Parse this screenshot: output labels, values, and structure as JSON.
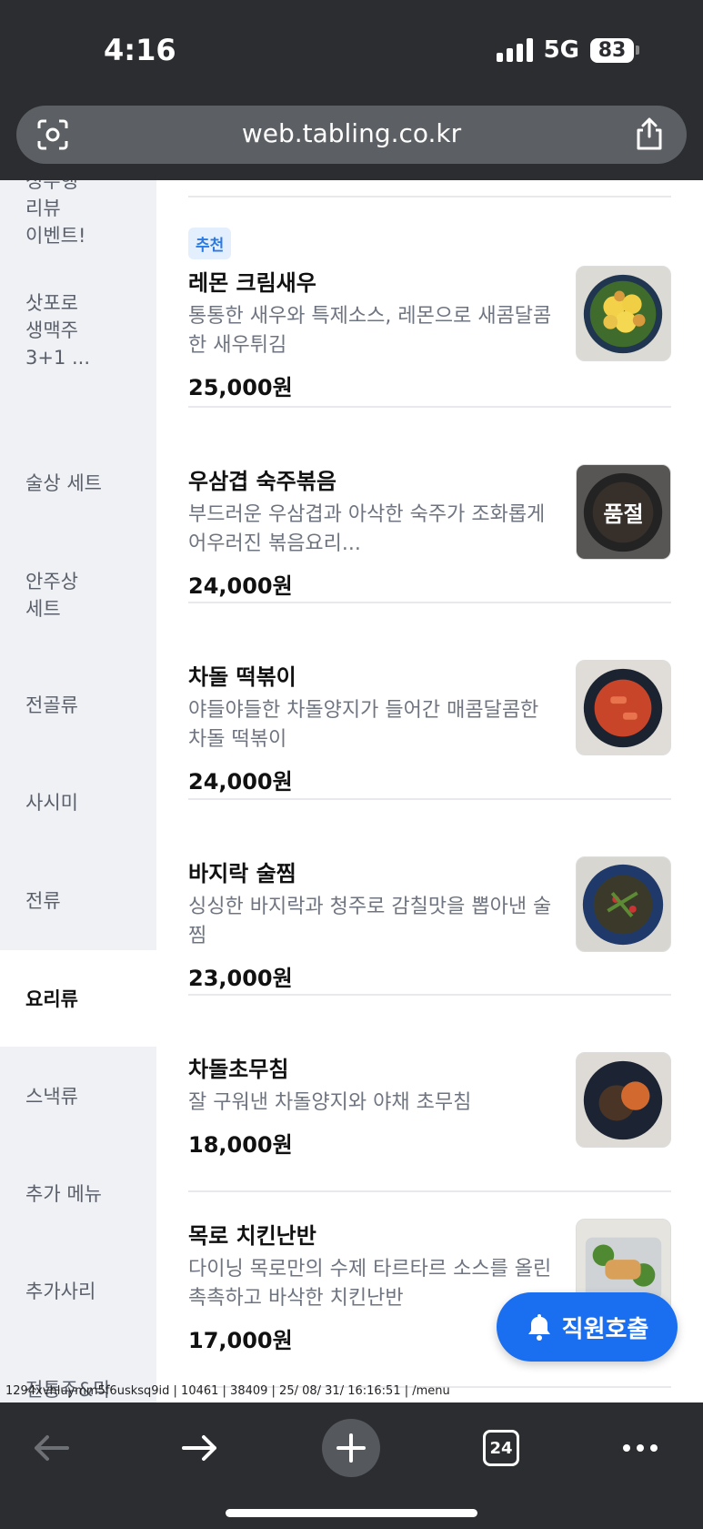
{
  "status_bar": {
    "time": "4:16",
    "network": "5G",
    "battery": "83"
  },
  "browser": {
    "url": "web.tabling.co.kr",
    "tab_count": "24"
  },
  "sidebar": {
    "items": [
      {
        "label": "정주행\n리뷰\n이벤트!",
        "active": false
      },
      {
        "label": "삿포로\n생맥주\n3+1 ...",
        "active": false
      },
      {
        "label": "술상 세트",
        "active": false
      },
      {
        "label": "안주상\n세트",
        "active": false
      },
      {
        "label": "전골류",
        "active": false
      },
      {
        "label": "사시미",
        "active": false
      },
      {
        "label": "전류",
        "active": false
      },
      {
        "label": "요리류",
        "active": true
      },
      {
        "label": "스낵류",
        "active": false
      },
      {
        "label": "추가 메뉴",
        "active": false
      },
      {
        "label": "추가사리",
        "active": false
      },
      {
        "label": "전통주&막",
        "active": false
      }
    ]
  },
  "menu": {
    "recommend_badge": "추천",
    "sold_out_label": "품절",
    "items": [
      {
        "name": "레몬 크림새우",
        "desc": "통통한 새우와 특제소스, 레몬으로 새콤달콤한 새우튀김",
        "price": "25,000원",
        "image": "lemon-cream-shrimp-photo"
      },
      {
        "name": "우삼겹 숙주볶음",
        "desc": "부드러운 우삼겹과 아삭한 숙주가 조화롭게 어우러진 볶음요리...",
        "price": "24,000원",
        "image": "beef-bean-sprout-photo",
        "sold_out": true
      },
      {
        "name": "차돌 떡볶이",
        "desc": "야들야들한 차돌양지가 들어간 매콤달콤한 차돌 떡볶이",
        "price": "24,000원",
        "image": "brisket-tteokbokki-photo"
      },
      {
        "name": "바지락 술찜",
        "desc": "싱싱한 바지락과 청주로 감칠맛을 뽑아낸 술찜",
        "price": "23,000원",
        "image": "clam-steamed-photo"
      },
      {
        "name": "차돌초무침",
        "desc": "잘 구워낸 차돌양지와 야채 초무침",
        "price": "18,000원",
        "image": "brisket-salad-photo"
      },
      {
        "name": "목로 치킨난반",
        "desc": "다이닝 목로만의 수제 타르타르 소스를 올린 촉촉하고 바삭한 치킨난반",
        "price": "17,000원",
        "image": "chicken-nanban-photo"
      }
    ]
  },
  "call_button": {
    "label": "직원호출"
  },
  "debug_text": "1294xvhluymm5f6usksq9id | 10461 | 38409 | 25/ 08/ 31/ 16:16:51 | /menu",
  "colors": {
    "accent": "#1a6ff0",
    "sidebar_bg": "#eff1f5",
    "chrome_bg": "#2b2d30"
  }
}
